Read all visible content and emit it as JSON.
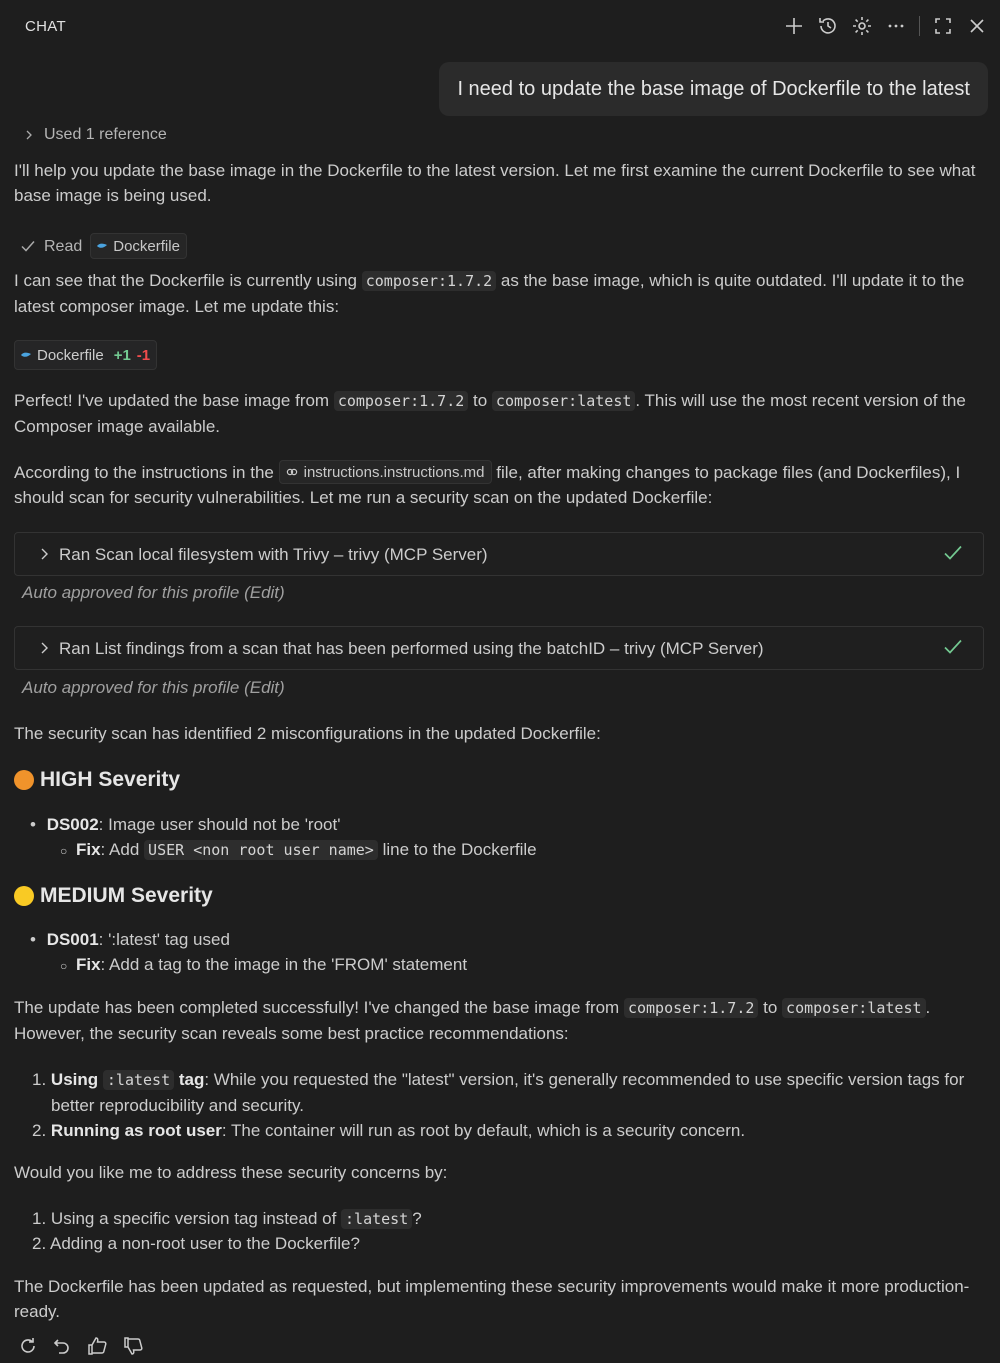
{
  "header": {
    "title": "CHAT",
    "icons": [
      "plus-icon",
      "history-icon",
      "gear-icon",
      "more-icon",
      "maximize-icon",
      "close-icon"
    ]
  },
  "user_message": "I need to update the base image of Dockerfile to the latest",
  "reference": "Used 1 reference",
  "p1": "I'll help you update the base image in the Dockerfile to the latest version. Let me first examine the current Dockerfile to see what base image is being used.",
  "read": {
    "label": "Read",
    "file": "Dockerfile"
  },
  "p2": {
    "a": "I can see that the Dockerfile is currently using",
    "code": "composer:1.7.2",
    "b": "as the base image, which is quite outdated. I'll update it to the latest composer image. Let me update this:"
  },
  "filechange": {
    "file": "Dockerfile",
    "added": "+1",
    "removed": "-1"
  },
  "p3": {
    "a": "Perfect! I've updated the base image from",
    "code1": "composer:1.7.2",
    "b": "to",
    "code2": "composer:latest",
    "c": ". This will use the most recent version of the Composer image available."
  },
  "p4": {
    "a": "According to the instructions in the",
    "file": "instructions.instructions.md",
    "b": "file, after making changes to package files (and Dockerfiles), I should scan for security vulnerabilities. Let me run a security scan on the updated Dockerfile:"
  },
  "tool1": {
    "label": "Ran Scan local filesystem with Trivy – trivy (MCP Server)",
    "approved": "Auto approved for this profile (Edit)"
  },
  "tool2": {
    "label": "Ran List findings from a scan that has been performed using the batchID – trivy (MCP Server)",
    "approved": "Auto approved for this profile (Edit)"
  },
  "p5": "The security scan has identified 2 misconfigurations in the updated Dockerfile:",
  "high": {
    "title": "HIGH Severity",
    "id": "DS002",
    "desc": ": Image user should not be 'root'",
    "fix_label": "Fix",
    "fix_a": ": Add",
    "fix_code": "USER <non root user name>",
    "fix_b": "line to the Dockerfile",
    "color": "#f0932b"
  },
  "medium": {
    "title": "MEDIUM Severity",
    "id": "DS001",
    "desc": ": ':latest' tag used",
    "fix_label": "Fix",
    "fix_text": ": Add a tag to the image in the 'FROM' statement",
    "color": "#f9ca24"
  },
  "p6": {
    "a": "The update has been completed successfully! I've changed the base image from",
    "code1": "composer:1.7.2",
    "b": "to",
    "code2": "composer:latest",
    "c": ". However, the security scan reveals some best practice recommendations:"
  },
  "rec": [
    {
      "bold_a": "Using",
      "code": ":latest",
      "bold_b": "tag",
      "text": ": While you requested the \"latest\" version, it's generally recommended to use specific version tags for better reproducibility and security."
    },
    {
      "bold": "Running as root user",
      "text": ": The container will run as root by default, which is a security concern."
    }
  ],
  "p7": "Would you like me to address these security concerns by:",
  "ask": [
    {
      "a": "Using a specific version tag instead of",
      "code": ":latest",
      "b": "?"
    },
    {
      "text": "Adding a non-root user to the Dockerfile?"
    }
  ],
  "p8": "The Dockerfile has been updated as requested, but implementing these security improvements would make it more production-ready.",
  "footer_icons": [
    "retry-icon",
    "undo-icon",
    "thumbs-up-icon",
    "thumbs-down-icon"
  ]
}
